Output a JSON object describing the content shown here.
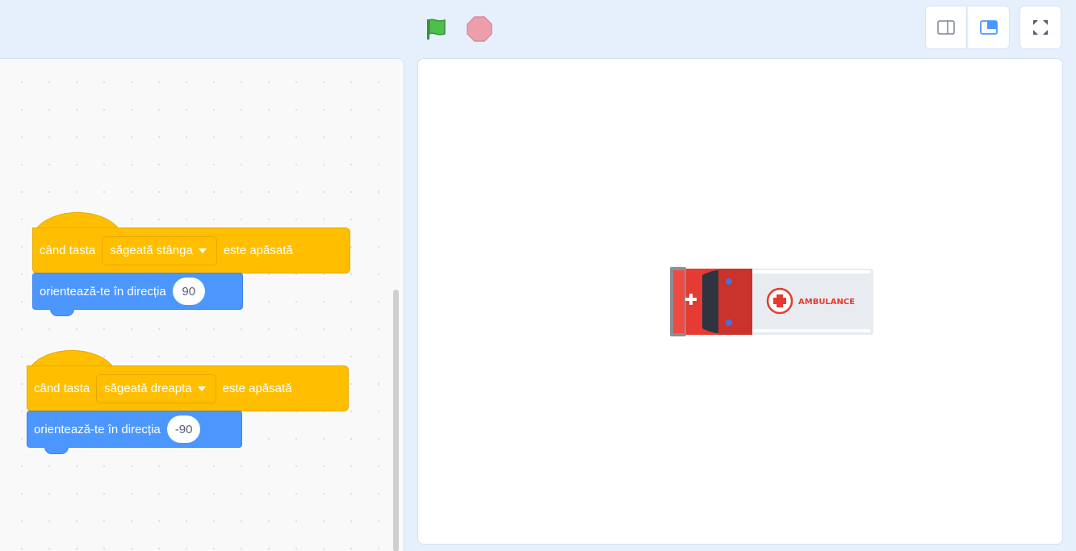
{
  "topbar": {
    "green_flag": "green-flag-icon",
    "stop": "stop-icon",
    "modes": [
      "small-stage-icon",
      "large-stage-icon",
      "fullscreen-icon"
    ]
  },
  "scripts": [
    {
      "hat_prefix": "când tasta",
      "key": "săgeată stânga",
      "hat_suffix": "este apăsată",
      "motion_label": "orientează-te în direcția",
      "direction": "90"
    },
    {
      "hat_prefix": "când tasta",
      "key": "săgeată dreapta",
      "hat_suffix": "este apăsată",
      "motion_label": "orientează-te în direcția",
      "direction": "-90"
    }
  ],
  "sprite": {
    "name_text": "AMBULANCE"
  },
  "colors": {
    "events": "#ffbf00",
    "motion": "#4c97ff",
    "flag": "#3ead3b",
    "stop": "#ec9fab"
  }
}
